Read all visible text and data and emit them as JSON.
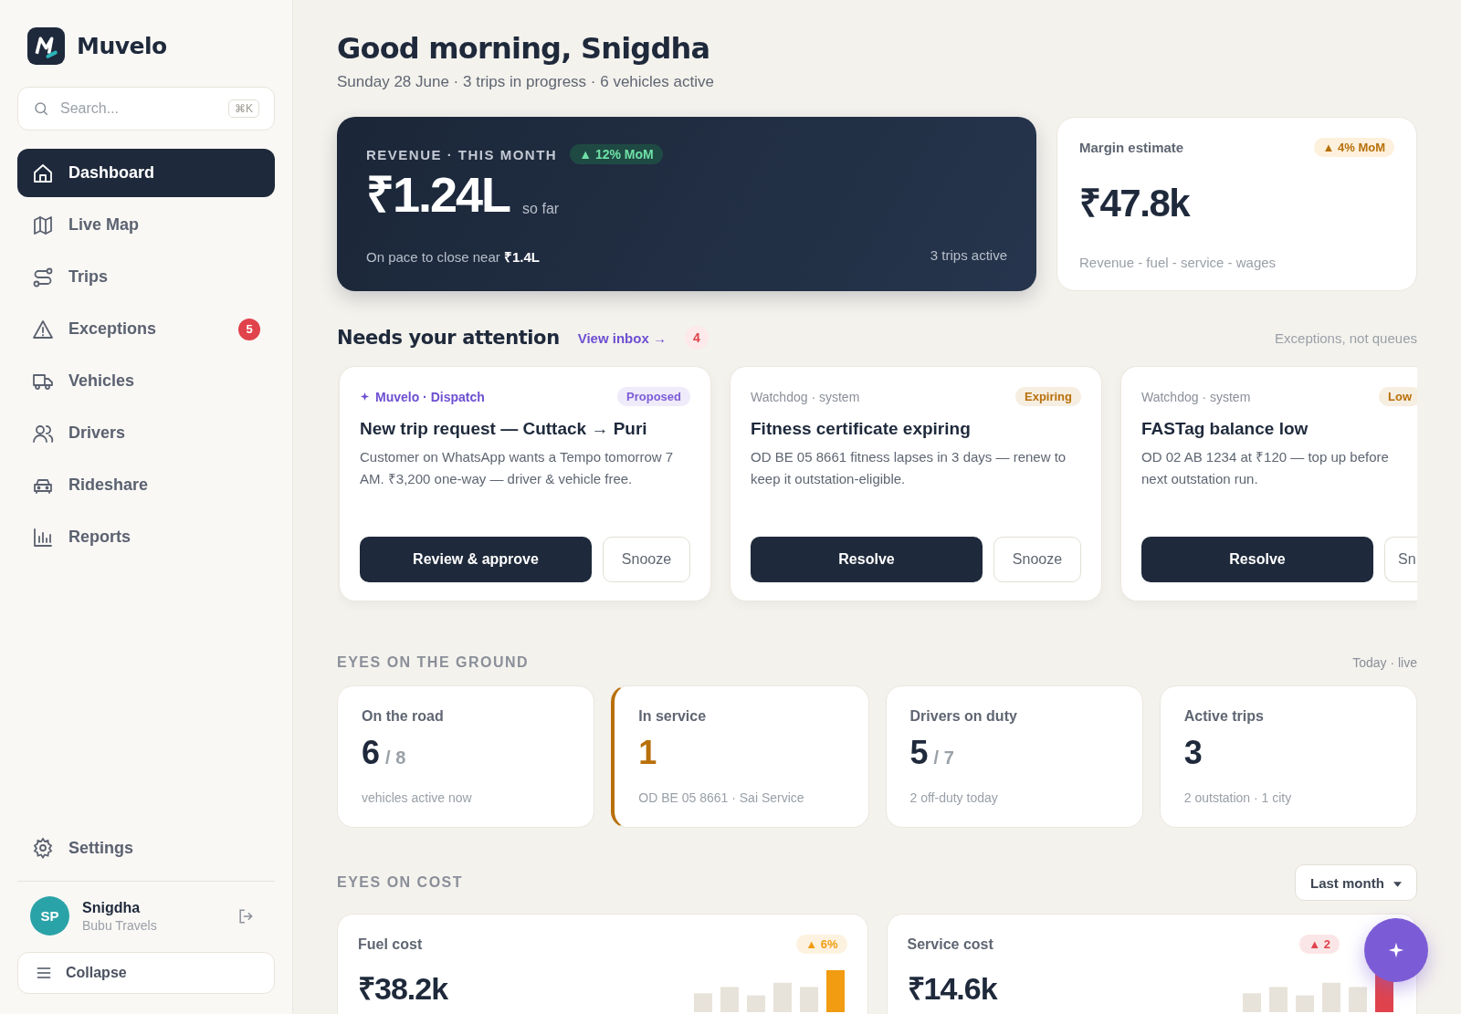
{
  "sidebar": {
    "brand": "Muvelo",
    "search": {
      "placeholder": "Search...",
      "shortcut": "⌘K"
    },
    "nav": [
      {
        "label": "Dashboard",
        "selected": true
      },
      {
        "label": "Live Map",
        "selected": false
      },
      {
        "label": "Trips",
        "selected": false
      },
      {
        "label": "Exceptions",
        "selected": false,
        "badge": "5"
      },
      {
        "label": "Vehicles",
        "selected": false
      },
      {
        "label": "Drivers",
        "selected": false
      },
      {
        "label": "Rideshare",
        "selected": false
      },
      {
        "label": "Reports",
        "selected": false
      }
    ],
    "settings": "Settings",
    "user": {
      "initials": "SP",
      "name": "Snigdha",
      "org": "Bubu Travels"
    },
    "collapse": "Collapse"
  },
  "header": {
    "greeting": "Good morning, Snigdha",
    "subtitle": "Sunday 28 June · 3 trips in progress · 6 vehicles active"
  },
  "revenue": {
    "label": "REVENUE · THIS MONTH",
    "change": "▲ 12% MoM",
    "value": "₹1.24L",
    "suffix": "so far",
    "pace": "On pace to close near **₹1.4L**",
    "trips": "3 trips active"
  },
  "margin": {
    "label": "Margin estimate",
    "change": "▲ 4% MoM",
    "value": "₹47.8k",
    "note": "Revenue - fuel - service - wages"
  },
  "attention": {
    "title": "Needs your attention",
    "link": "View inbox →",
    "count": "4",
    "note": "Exceptions, not queues",
    "items": [
      {
        "kind": "ai",
        "source": "Muvelo · Dispatch",
        "tag": "Proposed",
        "color": "#7c5cd6",
        "title": "New trip request — Cuttack → Puri",
        "body": "Customer on WhatsApp wants a Tempo tomorrow 7 AM. ₹3,200 one-way — driver & vehicle free.",
        "primary": "Review & approve",
        "secondary": "Snooze"
      },
      {
        "kind": "system",
        "source": "Watchdog · system",
        "tag": "Expiring",
        "color": "#b8700a",
        "title": "Fitness certificate expiring",
        "body": "OD BE 05 8661 fitness lapses in 3 days — renew to keep it outstation-eligible.",
        "primary": "Resolve",
        "secondary": "Snooze"
      },
      {
        "kind": "system",
        "source": "Watchdog · system",
        "tag": "Low",
        "color": "#b8700a",
        "title": "FASTag balance low",
        "body": "OD 02 AB 1234 at ₹120 — top up before next outstation run.",
        "primary": "Resolve",
        "secondary": "Sn"
      }
    ]
  },
  "ground": {
    "title": "EYES ON THE GROUND",
    "note": "Today · live",
    "stats": [
      {
        "label": "On the road",
        "value": "6",
        "total": "/ 8",
        "note": "vehicles active now",
        "alert": false
      },
      {
        "label": "In service",
        "value": "1",
        "note": "OD BE 05 8661 · Sai Service",
        "alert": true
      },
      {
        "label": "Drivers on duty",
        "value": "5",
        "total": "/ 7",
        "note": "2 off-duty today",
        "alert": false
      },
      {
        "label": "Active trips",
        "value": "3",
        "note": "2 outstation · 1 city",
        "alert": false
      }
    ]
  },
  "cost": {
    "title": "EYES ON COST",
    "period": "Last month",
    "cards": [
      {
        "label": "Fuel cost",
        "change": "▲ 6%",
        "color": "#f29c11",
        "value": "₹38.2k"
      },
      {
        "label": "Service cost",
        "change": "▲ 2",
        "color": "#e0434b",
        "value": "₹14.6k"
      }
    ]
  }
}
